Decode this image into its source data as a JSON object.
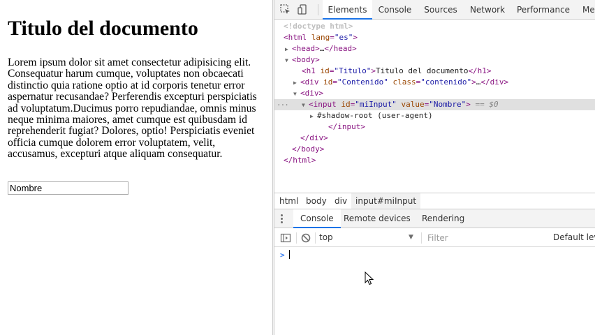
{
  "page": {
    "heading": "Titulo del documento",
    "paragraph_lines": [
      "Lorem ipsum dolor sit amet consectetur adipisicing elit.",
      "Consequatur harum cumque, voluptates non obcaecati",
      "distinctio quia ratione optio at id corporis tenetur error",
      "aspernatur recusandae? Perferendis excepturi perspiciatis",
      "ad voluptatum.Ducimus porro repudiandae, omnis minus",
      "neque minima maiores, amet cumque est quibusdam id",
      "reprehenderit fugiat? Dolores, optio! Perspiciatis eveniet",
      "officia cumque dolorem error voluptatem, velit,",
      "accusamus, excepturi atque aliquam consequatur."
    ],
    "input_value": "Nombre"
  },
  "devtools": {
    "tabs": [
      "Elements",
      "Console",
      "Sources",
      "Network",
      "Performance",
      "Me"
    ],
    "active_tab": "Elements",
    "dom": {
      "doctype": "<!doctype html>",
      "html_open": {
        "tag": "<html",
        "attr": "lang",
        "val": "\"es\"",
        "close": ">"
      },
      "head": {
        "tag": "<head>",
        "ellipsis": "…",
        "close": "</head>"
      },
      "body_open": "<body>",
      "h1": {
        "tag": "<h1",
        "attr": "id",
        "val": "\"Titulo\"",
        "gt": ">",
        "text": "Titulo del documento",
        "close": "</h1>"
      },
      "div_content": {
        "tag": "<div",
        "attr1": "id",
        "val1": "\"Contenido\"",
        "attr2": "class",
        "val2": "\"contenido\"",
        "gt": ">",
        "ellipsis": "…",
        "close": "</div>"
      },
      "div_open": "<div>",
      "input": {
        "tag": "<input",
        "attr1": "id",
        "val1": "\"miInput\"",
        "attr2": "value",
        "val2": "\"Nombre\"",
        "gt": ">",
        "eq0": "== $0"
      },
      "shadow_root": "#shadow-root (user-agent)",
      "input_close": "</input>",
      "div_close": "</div>",
      "body_close": "</body>",
      "html_close": "</html>",
      "dots": "..."
    },
    "breadcrumb": [
      "html",
      "body",
      "div",
      "input#miInput"
    ],
    "drawer_tabs": [
      "Console",
      "Remote devices",
      "Rendering"
    ],
    "console": {
      "context": "top",
      "filter_placeholder": "Filter",
      "levels": "Default levels",
      "prompt": ">"
    }
  },
  "colors": {
    "tag": "#881280",
    "attribute": "#994500",
    "value": "#1a1aa6",
    "accent": "#1a73e8"
  }
}
